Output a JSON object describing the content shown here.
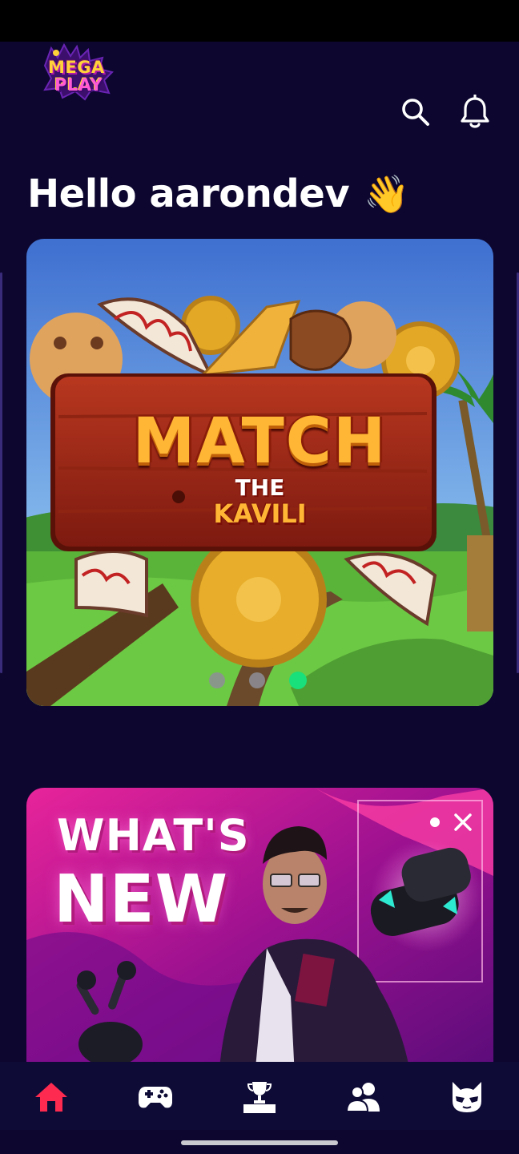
{
  "header": {
    "logo_line1": "MEGA",
    "logo_line2": "PLAY",
    "search_icon": "search-icon",
    "notification_icon": "bell-icon"
  },
  "greeting": {
    "text": "Hello aarondev",
    "emoji": "👋"
  },
  "carousel": {
    "title_main": "MATCH",
    "title_the": "THE",
    "title_sub": "KAVILI",
    "slides_count": 3,
    "active_slide": 3,
    "colors": {
      "sky": "#4e86d8",
      "grass": "#57b23a",
      "board": "#a6291b",
      "title": "#ffb634",
      "active_dot": "#19e07a"
    }
  },
  "news": {
    "line1": "WHAT'S",
    "line2": "NEW",
    "close_icon": "close-icon",
    "colors": {
      "background": "#b01390",
      "accent": "#ff3fa4"
    }
  },
  "bottom_nav": {
    "items": [
      {
        "name": "home",
        "icon": "home-icon",
        "active": true
      },
      {
        "name": "games",
        "icon": "gamepad-icon",
        "active": false
      },
      {
        "name": "leaderboard",
        "icon": "trophy-icon",
        "active": false
      },
      {
        "name": "friends",
        "icon": "users-icon",
        "active": false
      },
      {
        "name": "profile",
        "icon": "avatar-icon",
        "active": false
      }
    ],
    "active_color": "#ff2a4f"
  },
  "theme": {
    "background": "#0d0730",
    "nav_background": "#0e0b36"
  }
}
